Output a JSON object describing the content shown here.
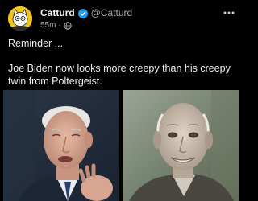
{
  "post": {
    "author_name": "Catturd",
    "author_handle": "@Catturd",
    "timestamp": "55m",
    "separator": "·",
    "verified": true,
    "text_line_1": "Reminder ...",
    "text_line_2": "Joe Biden now looks more creepy than his creepy twin from Poltergeist."
  },
  "icons": {
    "avatar": "cartoon-cat-avatar",
    "verified": "verified-badge-icon",
    "audience": "globe-icon",
    "more": "more-options-icon"
  },
  "images": [
    {
      "name": "photo-left",
      "description_visible": false
    },
    {
      "name": "photo-right",
      "description_visible": false
    }
  ],
  "colors": {
    "background": "#000000",
    "text_primary": "#eceef1",
    "text_secondary": "#a4a8ad",
    "verified_blue": "#1d9bf0",
    "avatar_yellow": "#f2c51c"
  }
}
